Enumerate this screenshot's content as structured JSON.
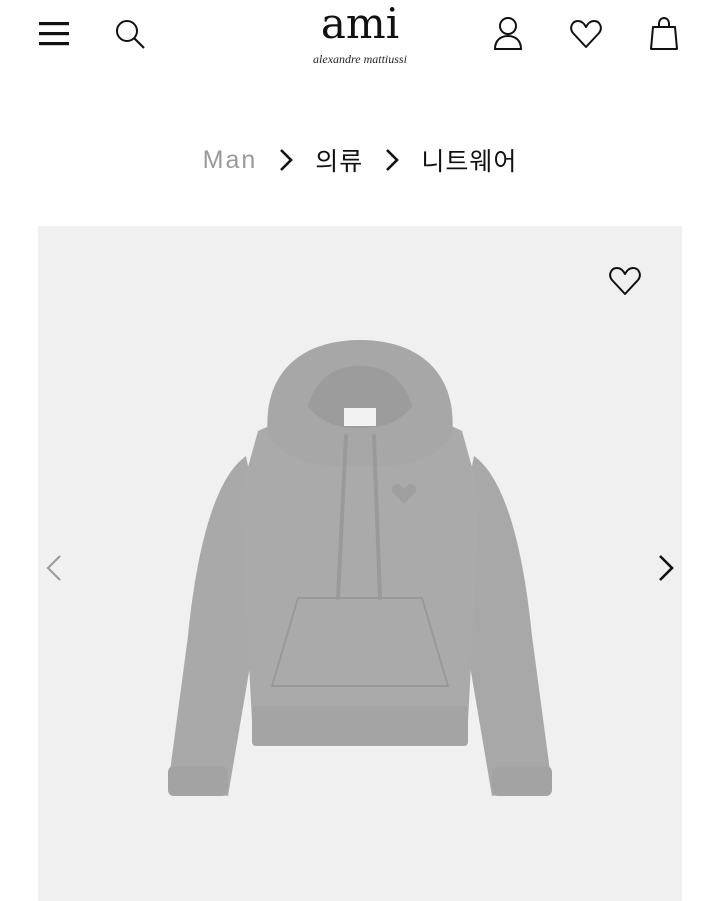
{
  "header": {
    "logo": {
      "main": "ami",
      "sub": "alexandre mattiussi"
    },
    "icons": {
      "menu": "hamburger-menu-icon",
      "search": "search-icon",
      "account": "user-icon",
      "wishlist": "heart-icon",
      "bag": "shopping-bag-icon"
    }
  },
  "breadcrumb": {
    "items": [
      "Man",
      "의류",
      "니트웨어"
    ],
    "separator_icon": "chevron-right-icon"
  },
  "product": {
    "image_description": "hoodie-image",
    "wishlist_icon": "heart-outline-icon",
    "prev_icon": "chevron-left-icon",
    "next_icon": "chevron-right-icon"
  },
  "colors": {
    "text": "#111111",
    "muted": "#9a9a9a",
    "image_bg": "#f0f0f0",
    "hoodie": "#a9a9a9"
  }
}
